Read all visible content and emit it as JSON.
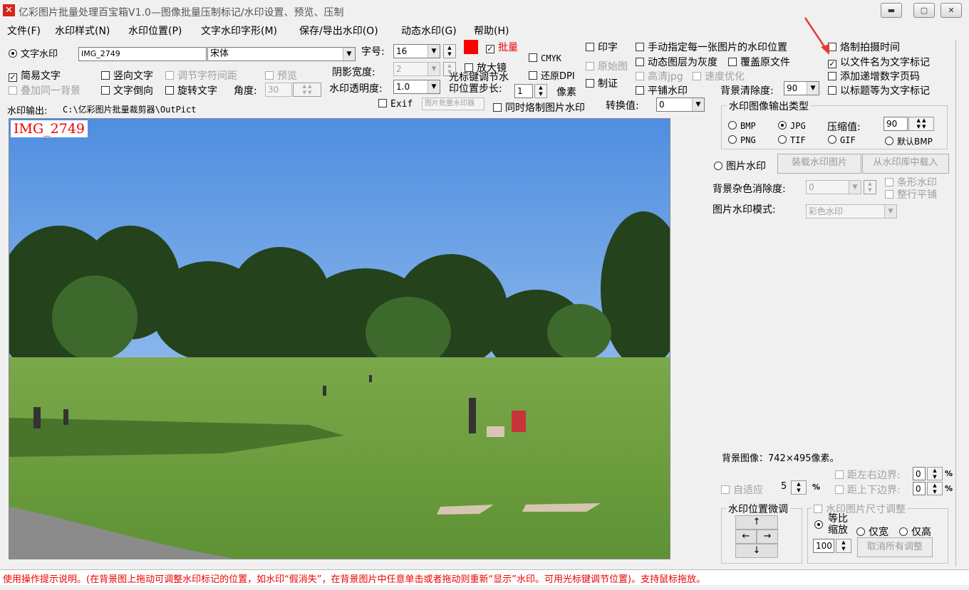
{
  "window": {
    "title": "亿彩图片批量处理百宝箱V1.0—图像批量压制标记/水印设置、预览、压制"
  },
  "menu": [
    "文件(F)",
    "水印样式(N)",
    "水印位置(P)",
    "文字水印字形(M)",
    "保存/导出水印(O)",
    "动态水印(G)",
    "帮助(H)"
  ],
  "text_wm": {
    "label": "文字水印",
    "text_value": "IMG_2749",
    "font": "宋体",
    "font_size_label": "字号:",
    "font_size": "16",
    "batch_label": "批量",
    "color": "#ff0000",
    "simple_text": "简易文字",
    "vertical_text": "竖向文字",
    "adjust_spacing": "调节字符间距",
    "preview": "预览",
    "shadow_label": "阴影宽度:",
    "shadow_value": "2",
    "overlay_bg": "叠加同一背景",
    "text_reverse": "文字倒向",
    "rotate_text": "旋转文字",
    "angle_label": "角度:",
    "angle_value": "30",
    "opacity_label": "水印透明度:",
    "opacity_value": "1.0",
    "magnifier": "放大镜",
    "cmyk": "CMYK",
    "restore_dpi": "还原DPI",
    "cursor_step_line1": "光标键调节水",
    "cursor_step_line2": "印位置步长:",
    "step_value": "1",
    "step_unit": "像素",
    "stamp": "印字",
    "original": "原始图",
    "make_cert": "制证",
    "exif": "Exif",
    "exif_field": "图片批量水印器",
    "same_time": "同时烙制图片水印",
    "convert_label": "转换值:",
    "convert_value": "0"
  },
  "options": {
    "manual_pos": "手动指定每一张图片的水印位置",
    "dynamic_gray": "动态图层为灰度",
    "cover_original": "覆盖原文件",
    "hd_jpg": "高清jpg",
    "speed_opt": "速度优化",
    "tile_wm": "平铺水印",
    "bg_clear_label": "背景清除度:",
    "bg_clear_value": "90",
    "burn_time": "烙制拍摄时间",
    "filename_mark": "以文件名为文字标记",
    "add_page_no": "添加递增数字页码",
    "title_mark": "以标题等为文字标记"
  },
  "output": {
    "label": "水印输出:",
    "path": "C:\\亿彩图片批量裁剪器\\OutPict"
  },
  "out_type": {
    "title": "水印图像输出类型",
    "bmp": "BMP",
    "jpg": "JPG",
    "compress_label": "压缩值:",
    "compress_value": "90",
    "png": "PNG",
    "tif": "TIF",
    "gif": "GIF",
    "default_bmp": "默认BMP"
  },
  "img_wm": {
    "label": "图片水印",
    "load_btn": "装载水印图片",
    "lib_btn": "从水印库中载入",
    "noise_label": "背景杂色消除度:",
    "noise_value": "0",
    "strip_wm": "条形水印",
    "tile_line": "整行平铺",
    "mode_label": "图片水印模式:",
    "mode_value": "彩色水印"
  },
  "preview": {
    "watermark_text": "IMG_2749"
  },
  "bg_info": "背景图像：742×495像素。",
  "margins": {
    "lr_label": "距左右边界:",
    "lr_value": "0",
    "tb_label": "距上下边界:",
    "tb_value": "0",
    "unit": "%",
    "adaptive": "自适应",
    "adaptive_value": "5",
    "adaptive_unit": "%"
  },
  "pos_adjust": {
    "title": "水印位置微调",
    "up": "↑",
    "left": "←",
    "right": "→",
    "down": "↓"
  },
  "size_adjust": {
    "title": "水印图片尺寸调整",
    "ratio_line1": "等比",
    "ratio_line2": "缩放",
    "width_only": "仅宽",
    "height_only": "仅高",
    "scale_value": "100",
    "cancel_btn": "取消所有调整"
  },
  "status": "使用操作提示说明。(在背景图上拖动可调整水印标记的位置，如水印“假消失”，在背景图片中任意单击或者拖动则重新“显示”水印。可用光标键调节位置)。支持鼠标拖放。"
}
